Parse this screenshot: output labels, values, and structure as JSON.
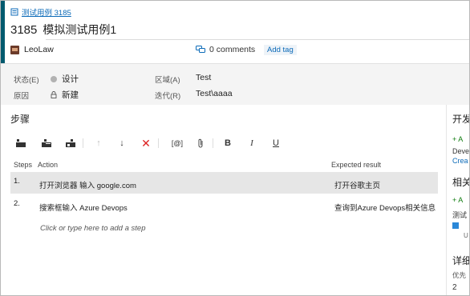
{
  "breadcrumb": {
    "text": "测试用例 3185"
  },
  "work_item": {
    "id": "3185",
    "title": "模拟测试用例1"
  },
  "meta": {
    "user": "LeoLaw",
    "comments": "0 comments",
    "add_tag": "Add tag"
  },
  "fields": {
    "state_label": "状态(E)",
    "state_value": "设计",
    "reason_label": "原因",
    "reason_value": "新建",
    "area_label": "区域(A)",
    "area_value": "Test",
    "iteration_label": "迭代(R)",
    "iteration_value": "Test\\aaaa"
  },
  "steps": {
    "title": "步骤",
    "headers": {
      "steps": "Steps",
      "action": "Action",
      "expected": "Expected result"
    },
    "rows": [
      {
        "num": "1.",
        "action": "打开浏览器 输入 google.com",
        "expected": "打开谷歌主页"
      },
      {
        "num": "2.",
        "action": "搜索框输入 Azure Devops",
        "expected": "查询到Azure Devops相关信息"
      }
    ],
    "add_hint": "Click or type here to add a step"
  },
  "toolbar": {
    "insert_step": "insert-step",
    "insert_shared": "insert-shared-steps",
    "insert_param": "insert-parameter",
    "move_up": "↑",
    "move_down": "↓",
    "delete": "✕",
    "param": "[@]",
    "attach": "attach",
    "bold": "B",
    "italic": "I",
    "underline": "U"
  },
  "right_panel": {
    "dev_title": "开发",
    "dev_add": "+ A",
    "dev_text": "Deve",
    "dev_link": "Crea",
    "related_title": "相关",
    "related_add": "+ A",
    "related_text": "测试",
    "related_sub": "U",
    "detail_title": "详细",
    "priority_label": "优先",
    "priority_value": "2"
  },
  "colors": {
    "accent": "#005a6e",
    "link": "#0b6ab8",
    "delete": "#dd2222",
    "selected_row": "#e6e6e6"
  }
}
